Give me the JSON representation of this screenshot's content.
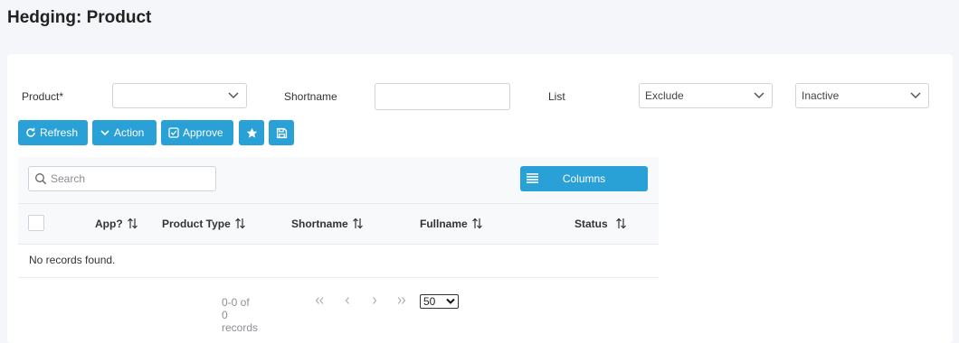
{
  "page": {
    "title": "Hedging: Product"
  },
  "filters": {
    "product_label": "Product*",
    "product_value": "",
    "shortname_label": "Shortname",
    "shortname_value": "",
    "list_label": "List",
    "list_value": "Exclude",
    "status_value": "Inactive"
  },
  "toolbar": {
    "refresh_label": "Refresh",
    "action_label": "Action",
    "approve_label": "Approve"
  },
  "table": {
    "search_placeholder": "Search",
    "columns_label": "Columns",
    "headers": [
      "App?",
      "Product Type",
      "Shortname",
      "Fullname",
      "Status"
    ],
    "empty_message": "No records found."
  },
  "pagination": {
    "summary": "0-0 of 0 records",
    "rows_per_page": "50"
  },
  "colors": {
    "accent": "#29a0d6",
    "background": "#f4f6f9"
  },
  "icons": [
    "refresh-icon",
    "chevron-down-icon",
    "check-square-icon",
    "star-icon",
    "save-icon",
    "search-icon",
    "columns-list-icon",
    "sort-icon"
  ]
}
